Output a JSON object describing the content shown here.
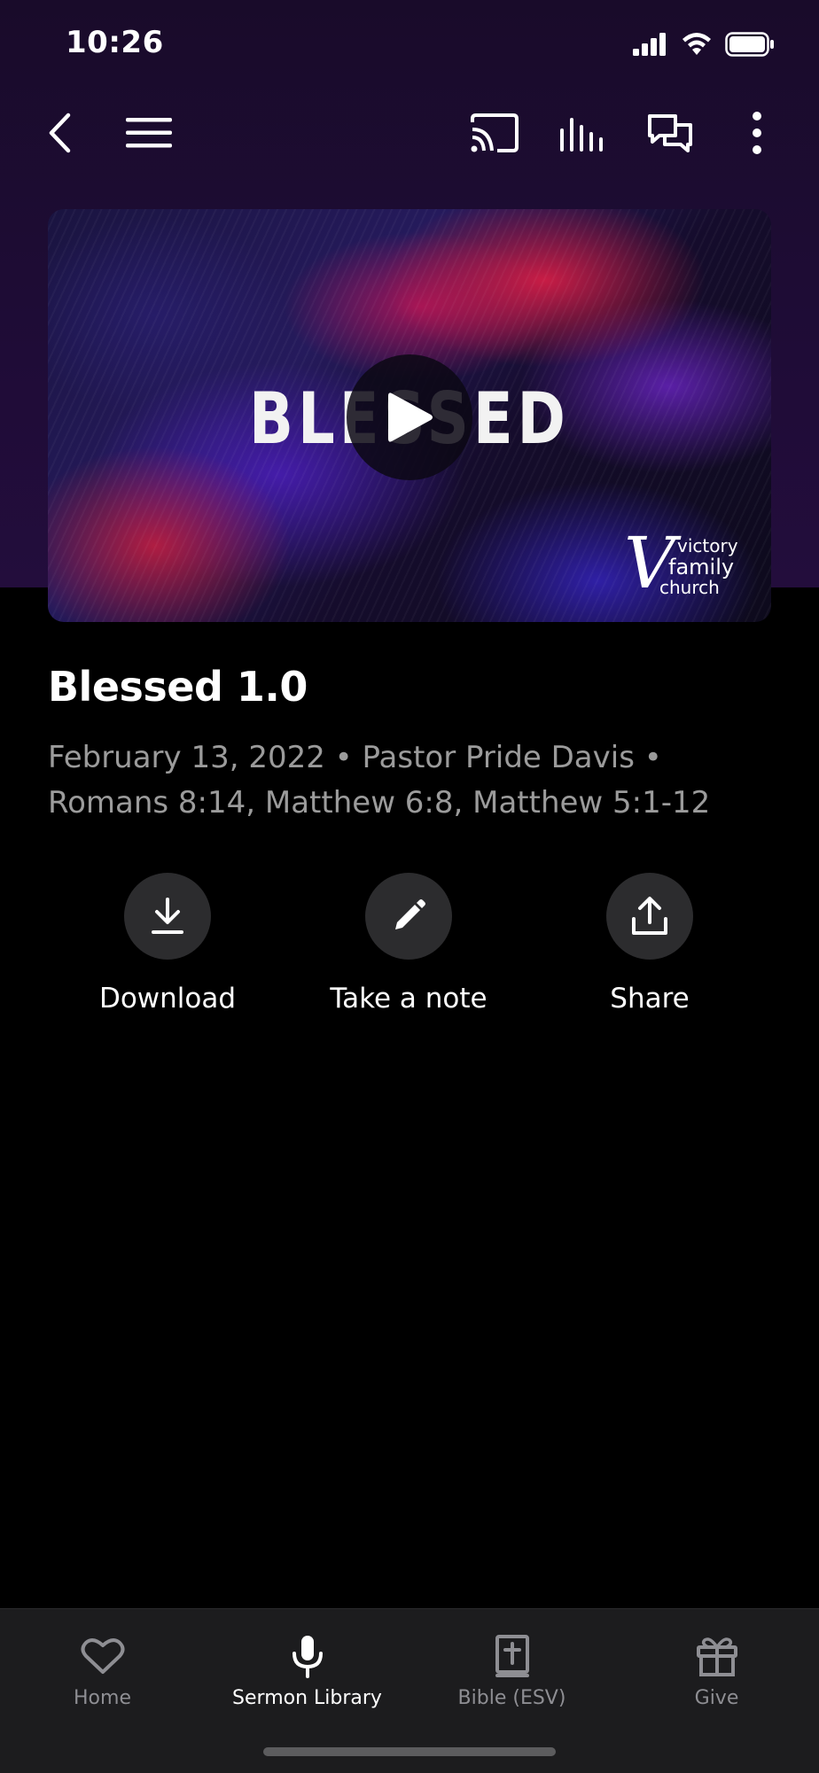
{
  "status_bar": {
    "time": "10:26",
    "icons": [
      "cellular-signal-icon",
      "wifi-icon",
      "battery-icon"
    ]
  },
  "top_nav": {
    "icons": [
      "back-chevron-icon",
      "menu-icon",
      "cast-icon",
      "audio-bars-icon",
      "chat-icon",
      "more-vertical-icon"
    ]
  },
  "hero": {
    "image_text": "BLESSED",
    "logo_lines": [
      "victory",
      "family",
      "church"
    ],
    "logo_letter": "V",
    "play_icon": "play-icon"
  },
  "sermon": {
    "title": "Blessed 1.0",
    "meta": "February 13, 2022 • Pastor Pride Davis • Romans 8:14, Matthew 6:8, Matthew 5:1-12"
  },
  "actions": [
    {
      "label": "Download",
      "icon": "download-icon"
    },
    {
      "label": "Take a note",
      "icon": "pencil-icon"
    },
    {
      "label": "Share",
      "icon": "share-icon"
    }
  ],
  "tabs": [
    {
      "label": "Home",
      "icon": "heart-icon",
      "active": false
    },
    {
      "label": "Sermon Library",
      "icon": "microphone-icon",
      "active": true
    },
    {
      "label": "Bible (ESV)",
      "icon": "bible-icon",
      "active": false
    },
    {
      "label": "Give",
      "icon": "gift-icon",
      "active": false
    }
  ],
  "colors": {
    "header_bg": "#1f0c37",
    "page_bg": "#000000",
    "muted_text": "#9b9b9b",
    "action_circle": "#2c2c2e",
    "tabbar_bg": "#1c1c1e"
  }
}
